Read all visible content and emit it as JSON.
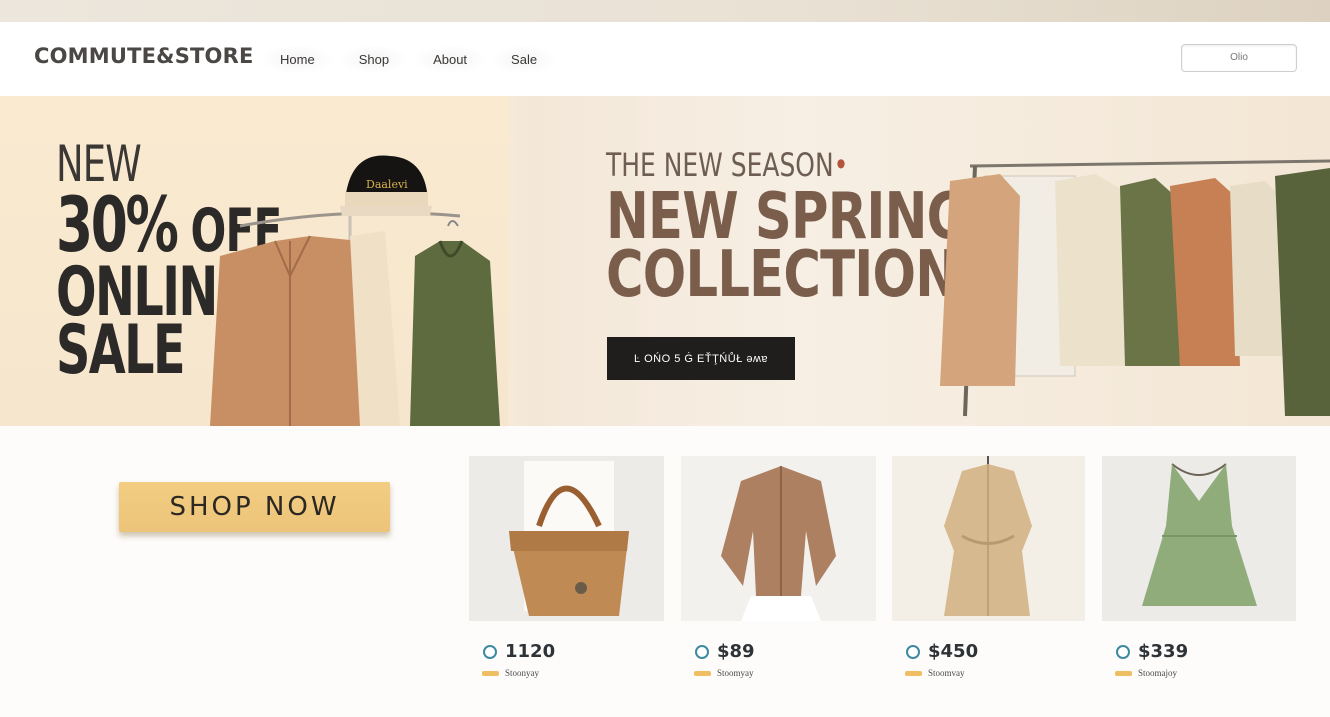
{
  "brand": {
    "logo": "COMMUTE&STORE"
  },
  "nav": [
    {
      "label": "Home"
    },
    {
      "label": "Shop"
    },
    {
      "label": "About"
    },
    {
      "label": "Sale"
    }
  ],
  "search": {
    "value": "Olio"
  },
  "promo": {
    "line1": "NEW",
    "line2a": "30%",
    "line2b": " OFF",
    "line3": "ONLINE",
    "line4": "SALE",
    "hat_text": "Daalevi"
  },
  "hero": {
    "season": "THE NEW SEASON",
    "collection_line1": "NEW SPRING",
    "collection_line2": "COLLECTION",
    "cta": "Ŀ OŃO 5 Ġ EŤŢŃŮŁ əʍɐ"
  },
  "shop_now": "SHOP NOW",
  "products": [
    {
      "price": "1120",
      "meta": "Stoonyay",
      "image": "tan-leather-handbag"
    },
    {
      "price": "$89",
      "meta": "Stoomyay",
      "image": "brown-trench-jacket"
    },
    {
      "price": "$450",
      "meta": "Stoomvay",
      "image": "beige-wool-coat"
    },
    {
      "price": "$339",
      "meta": "Stoomajoy",
      "image": "sage-green-dress"
    }
  ],
  "colors": {
    "accent_gold": "#efbe62",
    "icon_teal": "#3d8aa0",
    "headline_brown": "#7a5e4b",
    "dark_button": "#1f1e1d"
  }
}
